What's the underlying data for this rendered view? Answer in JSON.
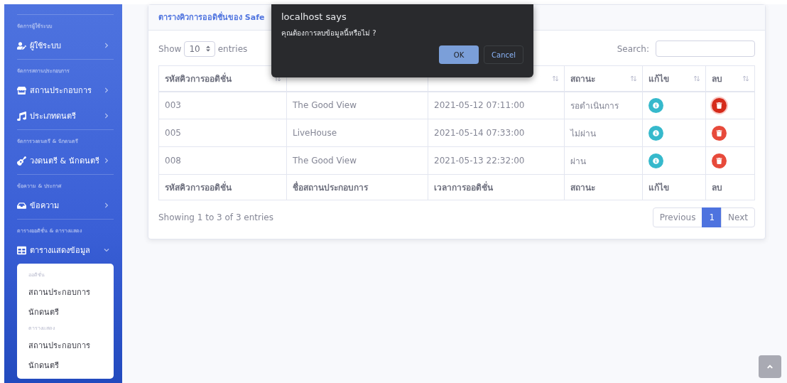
{
  "sidebar": {
    "sections": [
      {
        "heading": "จัดการผู้ใช้ระบบ",
        "items": [
          {
            "label": "ผู้ใช้ระบบ",
            "expanded": false
          }
        ]
      },
      {
        "heading": "จัดการสถานประกอบการ",
        "items": [
          {
            "label": "สถานประกอบการ",
            "expanded": false
          },
          {
            "label": "ประเภทดนตรี",
            "expanded": false
          }
        ]
      },
      {
        "heading": "จัดการวงดนตรี & นักดนตรี",
        "items": [
          {
            "label": "วงดนตรี & นักดนตรี",
            "expanded": false
          }
        ]
      },
      {
        "heading": "ข้อความ & ประกาศ",
        "items": [
          {
            "label": "ข้อความ",
            "expanded": false
          }
        ]
      },
      {
        "heading": "ตารางออดิชั่น & ตารางแสดง",
        "items": [
          {
            "label": "ตารางแสดงข้อมูล",
            "expanded": true,
            "submenu": [
              {
                "kind": "heading",
                "label": "ออดิชั่น"
              },
              {
                "kind": "link",
                "label": "สถานประกอบการ"
              },
              {
                "kind": "link",
                "label": "นักดนตรี"
              },
              {
                "kind": "heading",
                "label": "ตารางแสดง"
              },
              {
                "kind": "link",
                "label": "สถานประกอบการ"
              },
              {
                "kind": "link",
                "label": "นักดนตรี"
              }
            ]
          }
        ]
      }
    ]
  },
  "card": {
    "title": "ตารางคิวการออดิชั่นของ Safe",
    "length": {
      "label_before": "Show",
      "value": "10",
      "label_after": "entries"
    },
    "search": {
      "label": "Search:"
    },
    "table": {
      "header": [
        {
          "label": "รหัสคิวการออดิชั่น",
          "sort_icon": true
        },
        {
          "sort_icon": false
        },
        {
          "sort_icon": true
        },
        {
          "label": "สถานะ",
          "sort_icon": true
        },
        {
          "label": "แก้ไข",
          "sort_icon": true
        },
        {
          "label": "ลบ",
          "sort_icon": true
        }
      ],
      "rows": [
        {
          "cells": [
            "003",
            "The Good View",
            "2021-05-12 07:11:00",
            "รอดำเนินการ"
          ],
          "delete_focused": true
        },
        {
          "cells": [
            "005",
            "LiveHouse",
            "2021-05-14 07:33:00",
            "ไม่ผ่าน"
          ],
          "delete_focused": false
        },
        {
          "cells": [
            "008",
            "The Good View",
            "2021-05-13 22:32:00",
            "ผ่าน"
          ],
          "delete_focused": false
        }
      ],
      "footer": [
        "รหัสคิวการออดิชั่น",
        "ชื่อสถานประกอบการ",
        "เวลาการออดิชั่น",
        "สถานะ",
        "แก้ไข",
        "ลบ"
      ]
    },
    "info": "Showing 1 to 3 of 3 entries",
    "pagination": [
      {
        "label": "Previous",
        "selected": false
      },
      {
        "label": "1",
        "selected": true
      },
      {
        "label": "Next",
        "selected": false
      }
    ]
  },
  "dialog": {
    "title": "localhost says",
    "message": "คุณต้องการลบข้อมูลนี้หรือไม่ ?",
    "buttons": [
      {
        "label": "OK",
        "kind": "primary"
      },
      {
        "label": "Cancel",
        "kind": "secondary"
      }
    ]
  }
}
